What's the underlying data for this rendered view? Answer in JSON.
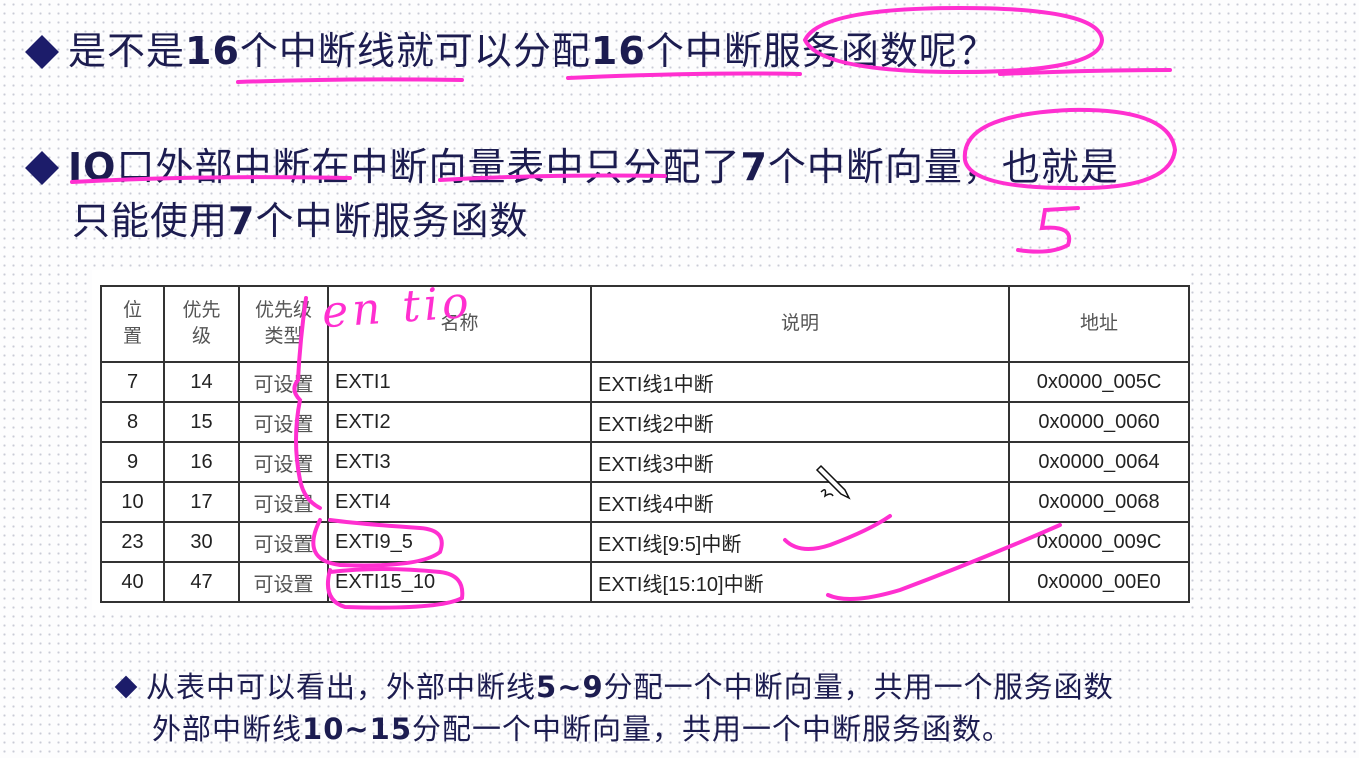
{
  "bullets": [
    {
      "parts": [
        "是不是",
        "16",
        "个中断线就可以分配",
        "16",
        "个中断服务函数呢？"
      ]
    },
    {
      "parts": [
        "IO",
        "口外部中断在中断向量表中只分配了",
        "7",
        "个中断向量，也就是"
      ],
      "continuation": [
        "只能使用",
        "7",
        "个中断服务函数"
      ]
    }
  ],
  "table": {
    "headers": [
      "位\n置",
      "优先\n级",
      "优先级\n类型",
      "名称",
      "说明",
      "地址"
    ],
    "rows": [
      [
        "7",
        "14",
        "可设置",
        "EXTI1",
        "EXTI线1中断",
        "0x0000_005C"
      ],
      [
        "8",
        "15",
        "可设置",
        "EXTI2",
        "EXTI线2中断",
        "0x0000_0060"
      ],
      [
        "9",
        "16",
        "可设置",
        "EXTI3",
        "EXTI线3中断",
        "0x0000_0064"
      ],
      [
        "10",
        "17",
        "可设置",
        "EXTI4",
        "EXTI线4中断",
        "0x0000_0068"
      ],
      [
        "23",
        "30",
        "可设置",
        "EXTI9_5",
        "EXTI线[9:5]中断",
        "0x0000_009C"
      ],
      [
        "40",
        "47",
        "可设置",
        "EXTI15_10",
        "EXTI线[15:10]中断",
        "0x0000_00E0"
      ]
    ]
  },
  "note": {
    "line1": [
      "从表中可以看出，外部中断线",
      "5~9",
      "分配一个中断向量，共用一个服务函数"
    ],
    "line2": [
      "外部中断线",
      "10~15",
      "分配一个中断向量，共用一个中断服务函数。"
    ]
  },
  "annotations": {
    "handwriting": "en tio",
    "handwriting_digit": "5",
    "ink_color": "#ff2fd0"
  }
}
